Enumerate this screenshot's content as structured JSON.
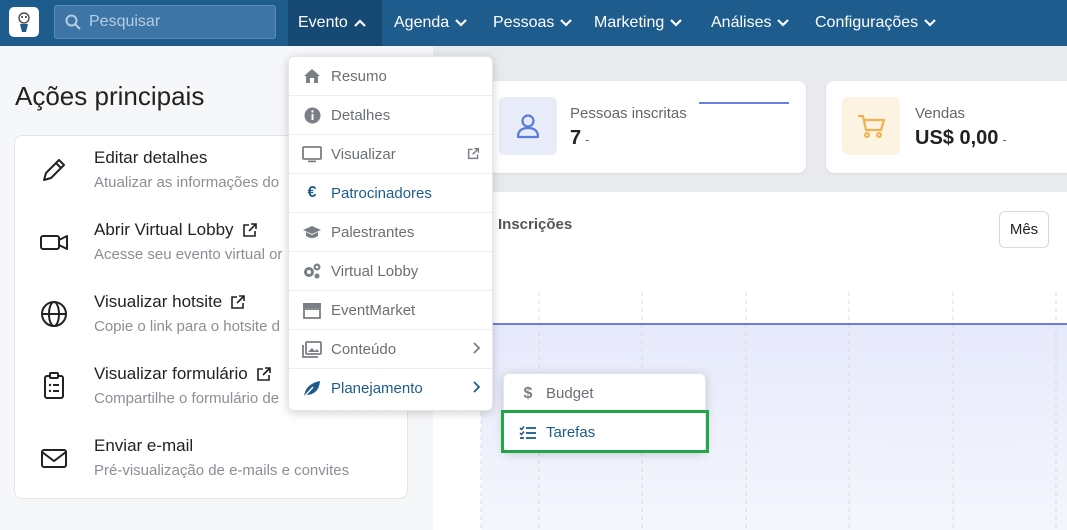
{
  "nav": {
    "search_placeholder": "Pesquisar",
    "items": [
      {
        "label": "Evento",
        "active": true
      },
      {
        "label": "Agenda"
      },
      {
        "label": "Pessoas"
      },
      {
        "label": "Marketing"
      },
      {
        "label": "Análises"
      },
      {
        "label": "Configurações"
      }
    ]
  },
  "left": {
    "heading": "Ações principais",
    "actions": [
      {
        "title": "Editar detalhes",
        "desc": "Atualizar as informações do",
        "icon": "pencil-icon"
      },
      {
        "title": "Abrir Virtual Lobby",
        "desc": "Acesse seu evento virtual or",
        "icon": "video-icon",
        "external": true
      },
      {
        "title": "Visualizar hotsite",
        "desc": "Copie o link para o hotsite d",
        "icon": "globe-icon",
        "external": true
      },
      {
        "title": "Visualizar formulário",
        "desc": "Compartilhe o formulário de",
        "icon": "clipboard-icon",
        "external": true
      },
      {
        "title": "Enviar e-mail",
        "desc": "Pré-visualização de e-mails e convites",
        "icon": "envelope-icon"
      }
    ]
  },
  "cards": {
    "inscritas": {
      "label": "Pessoas inscritas",
      "value": "7",
      "dash": "-"
    },
    "vendas": {
      "label": "Vendas",
      "value": "US$ 0,00",
      "dash": "-"
    }
  },
  "chart": {
    "title": "Inscrições",
    "period_button": "Mês"
  },
  "dropdown": {
    "items": [
      {
        "label": "Resumo",
        "icon": "home-icon"
      },
      {
        "label": "Detalhes",
        "icon": "info-icon"
      },
      {
        "label": "Visualizar",
        "icon": "monitor-icon",
        "external": true
      },
      {
        "label": "Patrocinadores",
        "icon": "euro-icon",
        "highlight": true
      },
      {
        "label": "Palestrantes",
        "icon": "graduation-cap-icon"
      },
      {
        "label": "Virtual Lobby",
        "icon": "gears-icon"
      },
      {
        "label": "EventMarket",
        "icon": "store-icon"
      },
      {
        "label": "Conteúdo",
        "icon": "images-icon",
        "submenu": true
      },
      {
        "label": "Planejamento",
        "icon": "leaf-icon",
        "submenu": true,
        "highlight": true
      }
    ]
  },
  "submenu": {
    "items": [
      {
        "label": "Budget",
        "icon": "dollar-icon"
      },
      {
        "label": "Tarefas",
        "icon": "tasks-icon",
        "highlight": true
      }
    ]
  },
  "colors": {
    "nav_bg": "#1e5c8e",
    "accent": "#1e5c8e",
    "chart_line": "#6b7fe0",
    "highlight_outline": "#22a64a"
  }
}
